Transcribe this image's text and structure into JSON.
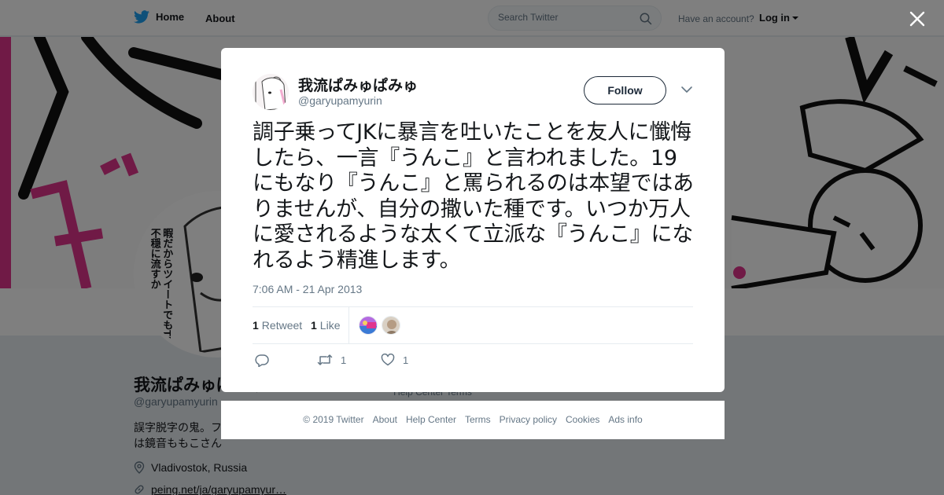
{
  "nav": {
    "home_label": "Home",
    "about_label": "About",
    "search_placeholder": "Search Twitter",
    "have_account": "Have an account?",
    "login_label": "Log in",
    "brand_color": "#1da1f2",
    "icons": [
      "twitter-bird-icon",
      "search-icon",
      "caret-down-icon"
    ]
  },
  "banner": {
    "accent_color": "#e0358d"
  },
  "profile": {
    "name": "我流ぱみゅぱみゅ",
    "handle": "@garyupamyurin",
    "bio": "誤字脱字の鬼。フ は鏡音ももこさん",
    "avatar_caption": "暇だからツイートでもTLに不穏に流すか",
    "location": "Vladivostok, Russia",
    "link": "peing.net/ja/garyupamyur…",
    "behind_footer": "Help Center    Terms"
  },
  "tweet": {
    "author_name": "我流ぱみゅぱみゅ",
    "author_handle": "@garyupamyurin",
    "follow_label": "Follow",
    "text": "調子乗ってJKに暴言を吐いたことを友人に懺悔したら、一言『うんこ』と言われました。19にもなり『うんこ』と罵られるのは本望ではありませんが、自分の撒いた種です。いつか万人に愛されるような太くて立派な『うんこ』になれるよう精進します。",
    "timestamp": "7:06 AM - 21 Apr 2013",
    "retweet_count": "1",
    "retweet_label": "Retweet",
    "like_count": "1",
    "like_label": "Like",
    "action_retweet_count": "1",
    "action_like_count": "1"
  },
  "footer": {
    "links": [
      "© 2019 Twitter",
      "About",
      "Help Center",
      "Terms",
      "Privacy policy",
      "Cookies",
      "Ads info"
    ]
  }
}
